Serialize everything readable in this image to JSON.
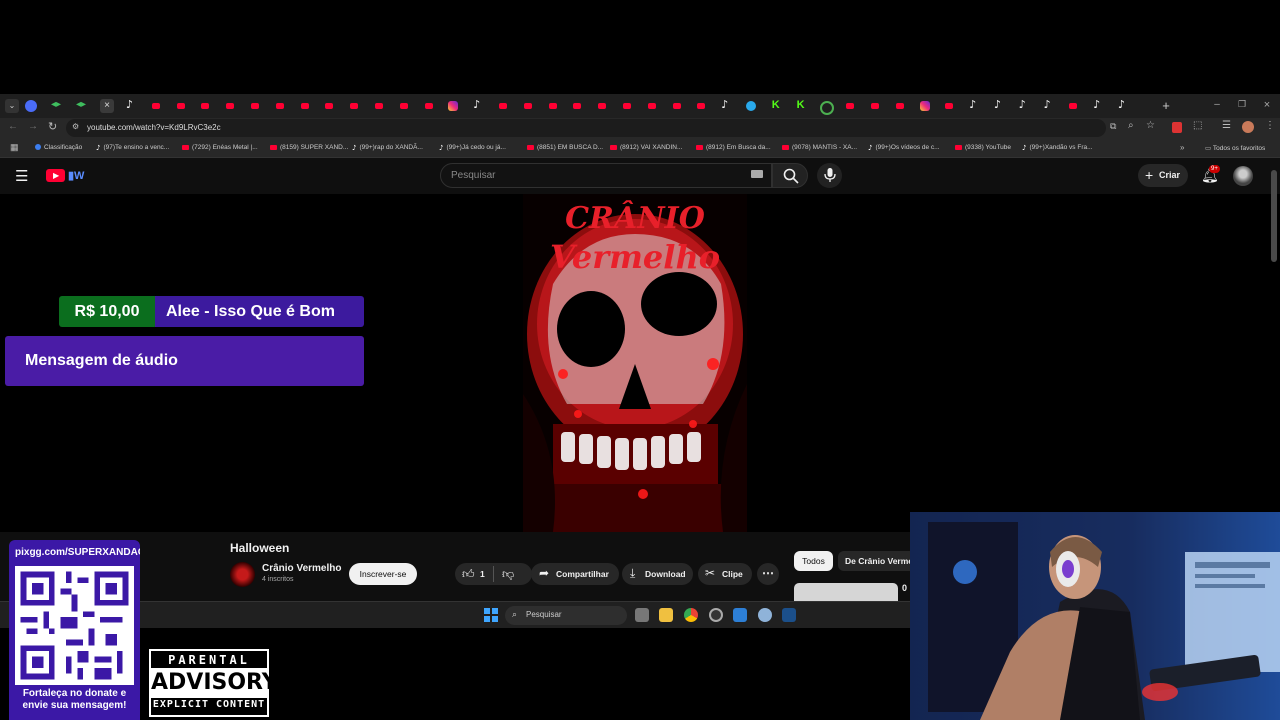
{
  "browser": {
    "url": "youtube.com/watch?v=Kd9LRvC3e2c",
    "bookmarks": [
      {
        "label": "Classificação",
        "kind": "cl"
      },
      {
        "label": "(97)Te ensino a venc...",
        "kind": "tt"
      },
      {
        "label": "(7292) Enéas Metal |...",
        "kind": "yt"
      },
      {
        "label": "(8159) SUPER XAND...",
        "kind": "yt"
      },
      {
        "label": "(99+)rap do XANDÃ...",
        "kind": "tt"
      },
      {
        "label": "(99+)Já cedo ou já...",
        "kind": "tt"
      },
      {
        "label": "(8851) EM BUSCA D...",
        "kind": "yt"
      },
      {
        "label": "(8912) VAI XANDIN...",
        "kind": "yt"
      },
      {
        "label": "(8912) Em Busca da...",
        "kind": "yt"
      },
      {
        "label": "(9078) MANTIS - XA...",
        "kind": "yt"
      },
      {
        "label": "(99+)Os vídeos de c...",
        "kind": "tt"
      },
      {
        "label": "(9338) YouTube",
        "kind": "yt"
      },
      {
        "label": "(99+)Xandão vs Fra...",
        "kind": "tt"
      }
    ],
    "all_bookmarks_label": "Todos os favoritos"
  },
  "youtube": {
    "search_placeholder": "Pesquisar",
    "create_label": "Criar",
    "notification_count": "9+",
    "cover_text": "CRÂNIO VERMELHO",
    "video_title": "Halloween",
    "channel_name": "Crânio Vermelho",
    "subscribers": "4 inscritos",
    "subscribe_label": "Inscrever-se",
    "like_count": "1",
    "share_label": "Compartilhar",
    "download_label": "Download",
    "clip_label": "Clipe",
    "chip_all": "Todos",
    "chip_channel": "De Crânio Vermelho",
    "side_count": "0"
  },
  "donation": {
    "amount": "R$ 10,00",
    "donor": "Alee - Isso Que é Bom",
    "type": "Mensagem de áudio"
  },
  "overlay": {
    "qr_url": "pixgg.com/SUPERXANDAO",
    "qr_caption_1": "Fortaleça no donate e",
    "qr_caption_2": "envie sua mensagem!",
    "advisory_top": "PARENTAL",
    "advisory_mid": "ADVISORY",
    "advisory_bottom": "EXPLICIT CONTENT"
  },
  "taskbar": {
    "search_placeholder": "Pesquisar"
  },
  "colors": {
    "donation_amount_bg": "#0b6e1e",
    "donation_bg": "#4a1ca6",
    "youtube_red": "#ff0033"
  }
}
